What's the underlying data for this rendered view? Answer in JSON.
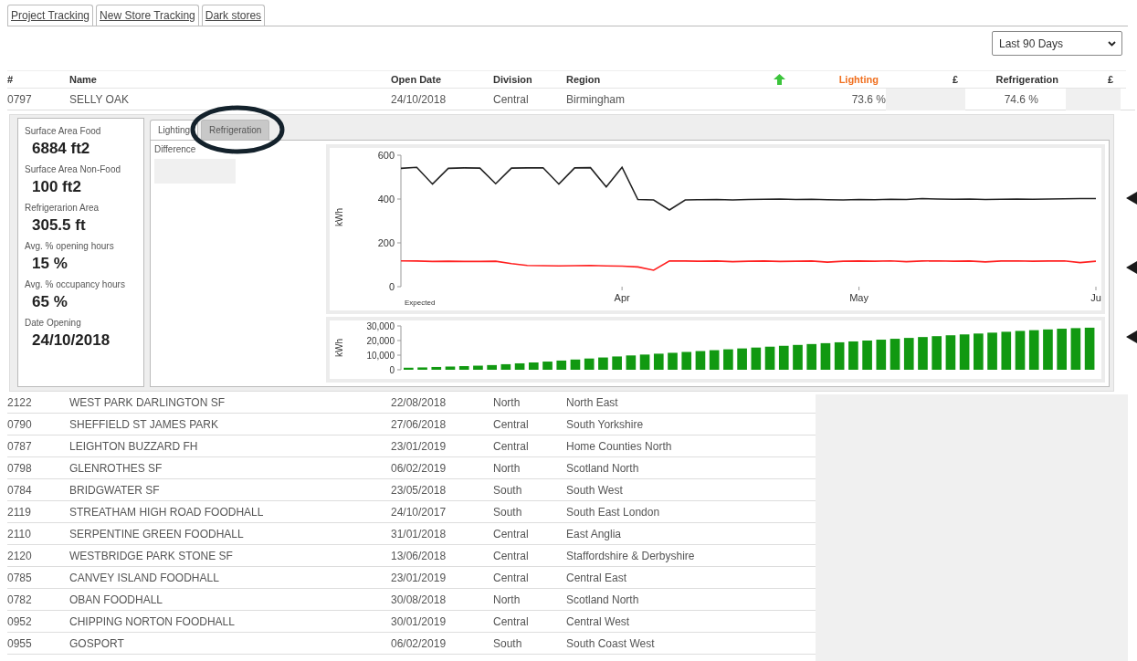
{
  "top_tabs": [
    {
      "label": "Project Tracking"
    },
    {
      "label": "New Store Tracking"
    },
    {
      "label": "Dark stores"
    }
  ],
  "period_select": {
    "value": "Last 90 Days"
  },
  "table": {
    "columns": [
      "#",
      "Name",
      "Open Date",
      "Division",
      "Region",
      "Lighting",
      "£",
      "Refrigeration",
      "£"
    ],
    "expanded_row": {
      "cells": [
        "0797",
        "SELLY OAK",
        "24/10/2018",
        "Central",
        "Birmingham"
      ],
      "lighting": "73.6 %",
      "refrigeration": "74.6 %",
      "details": {
        "stats": [
          {
            "label": "Surface Area Food",
            "value": "6884 ft2"
          },
          {
            "label": "Surface Area Non-Food",
            "value": "100 ft2"
          },
          {
            "label": "Refrigerarion Area",
            "value": "305.5 ft"
          },
          {
            "label": "Avg. % opening hours",
            "value": "15 %"
          },
          {
            "label": "Avg. % occupancy hours",
            "value": "65 %"
          },
          {
            "label": "Date Opening",
            "value": "24/10/2018"
          }
        ],
        "tabs": [
          {
            "label": "Lighting",
            "selected": true
          },
          {
            "label": "Refrigeration",
            "selected": false
          }
        ],
        "difference_label": "Difference",
        "legend": "Expected",
        "line_chart": {
          "chart_data": {
            "type": "line",
            "ylabel": "kWh",
            "ylim": [
              0,
              600
            ],
            "yticks": [
              0,
              200,
              400,
              600
            ],
            "categories": [
              null,
              null,
              null,
              null,
              null,
              null,
              null,
              null,
              null,
              null,
              null,
              null,
              null,
              null,
              "Apr",
              null,
              null,
              null,
              null,
              null,
              null,
              null,
              null,
              null,
              null,
              null,
              null,
              null,
              null,
              "May",
              null,
              null,
              null,
              null,
              null,
              null,
              null,
              null,
              null,
              null,
              null,
              null,
              null,
              null,
              "Ju"
            ],
            "series": [
              {
                "color": "#222222",
                "values": [
                  540,
                  545,
                  468,
                  540,
                  542,
                  541,
                  470,
                  541,
                  542,
                  543,
                  468,
                  542,
                  543,
                  455,
                  545,
                  398,
                  396,
                  350,
                  396,
                  397,
                  398,
                  396,
                  398,
                  399,
                  400,
                  398,
                  399,
                  397,
                  396,
                  398,
                  397,
                  399,
                  398,
                  402,
                  400,
                  399,
                  400,
                  398,
                  399,
                  400,
                  399,
                  400,
                  401,
                  402,
                  402
                ]
              },
              {
                "color": "#ff2020",
                "values": [
                  118,
                  117,
                  115,
                  116,
                  115,
                  115,
                  116,
                  105,
                  97,
                  96,
                  95,
                  96,
                  97,
                  95,
                  94,
                  90,
                  75,
                  117,
                  117,
                  116,
                  117,
                  114,
                  116,
                  117,
                  115,
                  116,
                  117,
                  112,
                  116,
                  117,
                  116,
                  118,
                  114,
                  117,
                  118,
                  116,
                  117,
                  113,
                  117,
                  118,
                  116,
                  117,
                  118,
                  110,
                  116
                ]
              }
            ]
          }
        },
        "bar_chart": {
          "chart_data": {
            "type": "bar",
            "ylabel": "kWh",
            "ylim": [
              0,
              30000
            ],
            "yticks": [
              {
                "value": 0,
                "label": "0"
              },
              {
                "value": 10000,
                "label": "10,000"
              },
              {
                "value": 20000,
                "label": "20,000"
              },
              {
                "value": 30000,
                "label": "30,000"
              }
            ],
            "categories": [
              null,
              null,
              null,
              null,
              null,
              null,
              null,
              null,
              null,
              null,
              null,
              null,
              null,
              null,
              null,
              null,
              null,
              null,
              null,
              null,
              null,
              null,
              null,
              null,
              null,
              null,
              null,
              null,
              null,
              null,
              null,
              null,
              null,
              null,
              null,
              null,
              null,
              null,
              null,
              null,
              null,
              null,
              null,
              null,
              null,
              null,
              null,
              null,
              null,
              null
            ],
            "series": [
              {
                "color": "#119911",
                "values": [
                  1400,
                  1600,
                  1900,
                  2200,
                  2500,
                  2800,
                  3200,
                  3800,
                  4400,
                  5000,
                  5600,
                  6300,
                  7000,
                  7700,
                  8400,
                  9100,
                  9800,
                  10400,
                  11000,
                  11600,
                  12200,
                  12800,
                  13400,
                  14000,
                  14600,
                  15200,
                  15800,
                  16400,
                  17000,
                  17600,
                  18200,
                  18800,
                  19400,
                  20000,
                  20600,
                  21200,
                  21800,
                  22400,
                  23000,
                  23600,
                  24200,
                  24800,
                  25400,
                  26000,
                  26600,
                  27100,
                  27600,
                  28100,
                  28500,
                  28800
                ]
              }
            ]
          }
        }
      }
    },
    "rows": [
      {
        "cells": [
          "2122",
          "WEST PARK DARLINGTON SF",
          "22/08/2018",
          "North",
          "North East"
        ]
      },
      {
        "cells": [
          "0790",
          "SHEFFIELD ST JAMES PARK",
          "27/06/2018",
          "Central",
          "South Yorkshire"
        ]
      },
      {
        "cells": [
          "0787",
          "LEIGHTON BUZZARD FH",
          "23/01/2019",
          "Central",
          "Home Counties North"
        ]
      },
      {
        "cells": [
          "0798",
          "GLENROTHES SF",
          "06/02/2019",
          "North",
          "Scotland North"
        ]
      },
      {
        "cells": [
          "0784",
          "BRIDGWATER SF",
          "23/05/2018",
          "South",
          "South West"
        ]
      },
      {
        "cells": [
          "2119",
          "STREATHAM HIGH ROAD FOODHALL",
          "24/10/2017",
          "South",
          "South East London"
        ]
      },
      {
        "cells": [
          "2110",
          "SERPENTINE GREEN FOODHALL",
          "31/01/2018",
          "Central",
          "East Anglia"
        ]
      },
      {
        "cells": [
          "2120",
          "WESTBRIDGE PARK STONE SF",
          "13/06/2018",
          "Central",
          "Staffordshire & Derbyshire"
        ]
      },
      {
        "cells": [
          "0785",
          "CANVEY ISLAND FOODHALL",
          "23/01/2019",
          "Central",
          "Central East"
        ]
      },
      {
        "cells": [
          "0782",
          "OBAN FOODHALL",
          "30/08/2018",
          "North",
          "Scotland North"
        ]
      },
      {
        "cells": [
          "0952",
          "CHIPPING NORTON FOODHALL",
          "30/01/2019",
          "Central",
          "Central West"
        ]
      },
      {
        "cells": [
          "0955",
          "GOSPORT",
          "06/02/2019",
          "South",
          "South Coast West"
        ]
      }
    ]
  }
}
